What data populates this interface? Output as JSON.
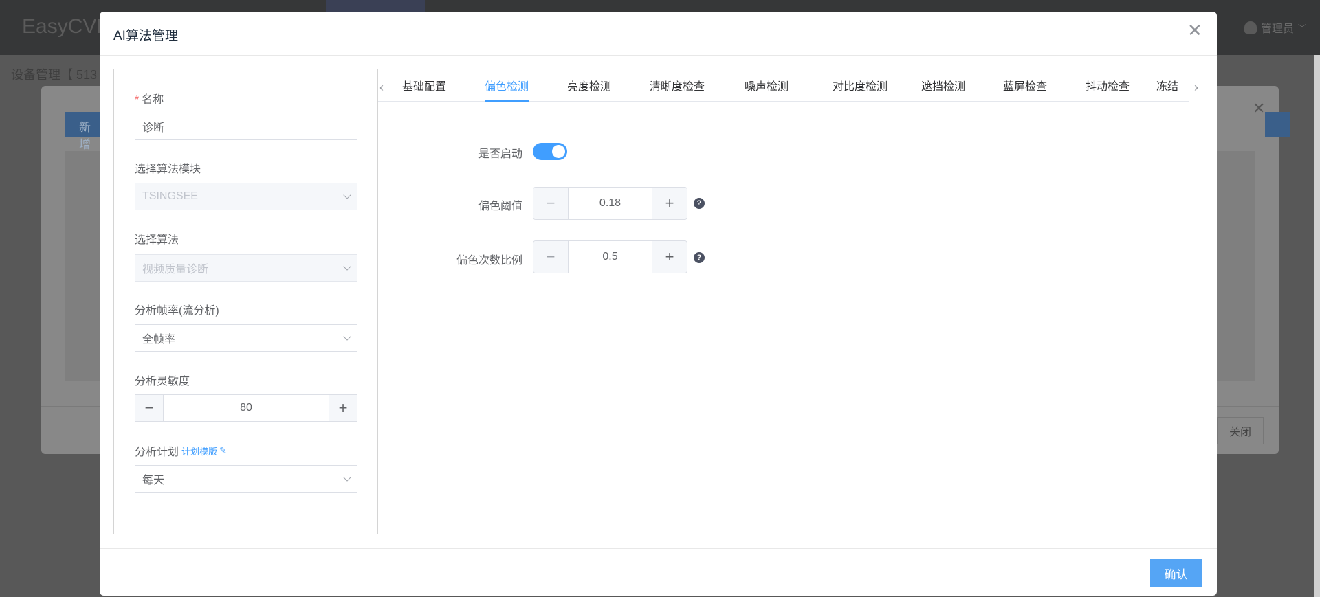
{
  "background": {
    "brand": "EasyCVR",
    "user": "管理员",
    "breadcrumb": "设备管理【 513",
    "add_button": "新增",
    "close_button": "关闭"
  },
  "modal": {
    "title": "AI算法管理",
    "confirm": "确认",
    "left": {
      "name_label": "名称",
      "name_value": "诊断",
      "module_label": "选择算法模块",
      "module_value": "TSINGSEE",
      "algo_label": "选择算法",
      "algo_value": "视频质量诊断",
      "fps_label": "分析帧率(流分析)",
      "fps_value": "全帧率",
      "sens_label": "分析灵敏度",
      "sens_value": "80",
      "plan_label": "分析计划",
      "plan_link": "计划模版",
      "plan_value": "每天"
    },
    "tabs": [
      "基础配置",
      "偏色检测",
      "亮度检测",
      "清晰度检查",
      "噪声检测",
      "对比度检测",
      "遮挡检测",
      "蓝屏检查",
      "抖动检查",
      "冻结"
    ],
    "active_tab": "偏色检测",
    "settings": {
      "enable_label": "是否启动",
      "enabled": true,
      "threshold_label": "偏色阈值",
      "threshold_value": "0.18",
      "ratio_label": "偏色次数比例",
      "ratio_value": "0.5"
    }
  },
  "colors": {
    "accent": "#409eff",
    "confirm": "#55a5f5",
    "required": "#f56c6c"
  }
}
